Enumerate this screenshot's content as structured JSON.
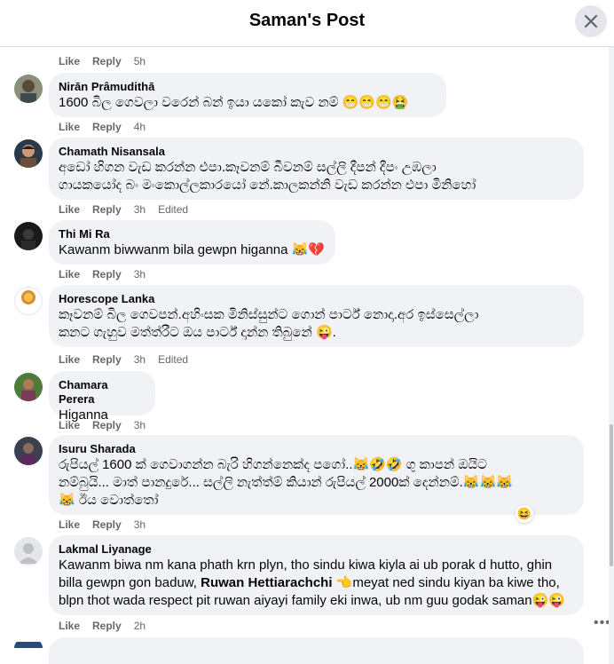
{
  "header": {
    "title": "Saman's Post"
  },
  "labels": {
    "like": "Like",
    "reply": "Reply",
    "edited": "Edited"
  },
  "comments": [
    {
      "name": "",
      "text": "",
      "time": "5h"
    },
    {
      "name": "Nirān Prâmudithā",
      "text": "1600 බිල ගෙවලා වරෙන් බන් ඉයා යකෝ කැව නම් 😁😁😁🤮",
      "time": "4h"
    },
    {
      "name": "Chamath Nisansala",
      "text": "අඩෝ හිගන වැඩ කරන්න එපා.කෑවනම් බීවනම් සල්ලි දීපන් දීපං උඹලා\nගායකයෝද බං මංකොල්ලකාරයෝ නේ.කාලකන්නි වැඩ කරන්න එපා මිනිහෝ",
      "time": "3h",
      "edited": true
    },
    {
      "name": "Thi Mi Ra",
      "text": "Kawanm biwwanm bila gewpn higanna 😹💔",
      "time": "3h"
    },
    {
      "name": "Horescope Lanka",
      "text": "කෑවනම් බිල ගෙවපන්.අහිංසක මිනිස්සුන්ට ගොන් පාර්ට් නොදා.අර ඉස්සෙල්ලා\nකනට ගැහුව මත්ත්රීට ඔය පාර්ට් දාන්න තිබුනේ 😜.",
      "time": "3h",
      "edited": true,
      "avatar_text": "Horescop Lanka"
    },
    {
      "name": "Chamara Perera",
      "text": "Higanna",
      "time": "3h"
    },
    {
      "name": "Isuru Sharada",
      "text": "රුපියල් 1600 ක් ගෙවාගන්න බැරි හිගන්නෙක්ද පගෝ..😹🤣🤣 ගු කාපන් ඔයිට\nනම්බුයි... මාත් පානදුරේ... සල්ලි නැත්ත්ම් කියාන් රුපියල් 2000ක් දෙන්නම්.😹😹😹\n😹 ඊය වොත්තෝ",
      "time": "3h",
      "reaction": "😆"
    },
    {
      "name": "Lakmal Liyanage",
      "text_before": "Kawanm biwa nm kana phath krn plyn, tho sindu kiwa kiyla ai ub porak d hutto, ghin\nbilla gewpn gon baduw, ",
      "mention": "Ruwan Hettiarachchi",
      "text_after": " 👈meyat ned sindu kiyan ba kiwe tho,\nblpn thot wada respect pit ruwan aiyayi family eki inwa, ub nm guu godak saman😜😜",
      "time": "2h"
    }
  ],
  "icons": {
    "close": "close-icon",
    "more": "more-options-icon"
  },
  "colors": {
    "bubble": "#f0f2f5",
    "meta": "#65676b",
    "text": "#050505"
  }
}
